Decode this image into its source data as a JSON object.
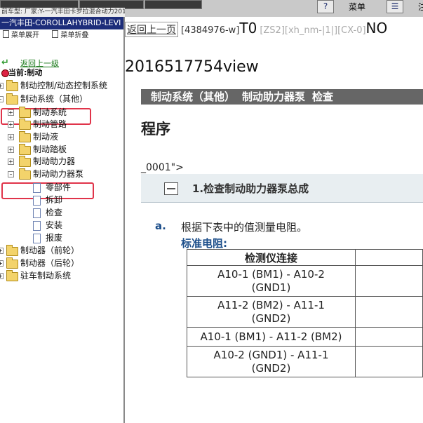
{
  "topbar": {
    "model_label": "前车型: 厂家:Y-一汽丰田卡罗拉混合动力2017",
    "menu_label": "菜单",
    "cut_label": "注",
    "icon_a": "help-icon",
    "icon_b": "menu-icon"
  },
  "sidebar": {
    "title": "一汽丰田-COROLLAHYBRID-LEVI",
    "expand_label": "菜单展开",
    "collapse_label": "菜单折叠",
    "back_label": "返回上一级",
    "current_label": "当前:制动",
    "items": [
      {
        "label": "制动控制/动态控制系统"
      },
      {
        "label": "制动系统（其他）"
      },
      {
        "label": "制动系统"
      },
      {
        "label": "制动管路"
      },
      {
        "label": "制动液"
      },
      {
        "label": "制动踏板"
      },
      {
        "label": "制动助力器"
      },
      {
        "label": "制动助力器泵"
      },
      {
        "label": "零部件"
      },
      {
        "label": "拆卸"
      },
      {
        "label": "检查"
      },
      {
        "label": "安装"
      },
      {
        "label": "报废"
      },
      {
        "label": "制动器（前轮）"
      },
      {
        "label": "制动器（后轮）"
      },
      {
        "label": "驻车制动系统"
      }
    ],
    "highlight_color": "#e0344a"
  },
  "main": {
    "back_button": "返回上一页",
    "doc_ref": "[4384976-w]",
    "t0": "T0",
    "grey_ref": "[ZS2][xh_nm-|1|][CX-0]",
    "no": "NO",
    "view_id": "2016517754view",
    "breadcrumb": [
      "制动系统（其他）",
      "制动助力器泵",
      "检查"
    ],
    "page_title": "程序",
    "fragment": "_0001\">",
    "step_title": "1.检查制动助力器泵总成",
    "substep_marker": "a.",
    "substep_text": "根据下表中的值测量电阻。",
    "std_label": "标准电阻:",
    "table": {
      "headers": [
        "检测仪连接",
        ""
      ],
      "rows": [
        [
          "A10-1 (BM1) - A10-2 (GND1)",
          ""
        ],
        [
          "A11-2 (BM2) - A11-1 (GND2)",
          ""
        ],
        [
          "A10-1 (BM1) - A11-2 (BM2)",
          ""
        ],
        [
          "A10-2 (GND1) - A11-1 (GND2)",
          ""
        ]
      ]
    }
  }
}
